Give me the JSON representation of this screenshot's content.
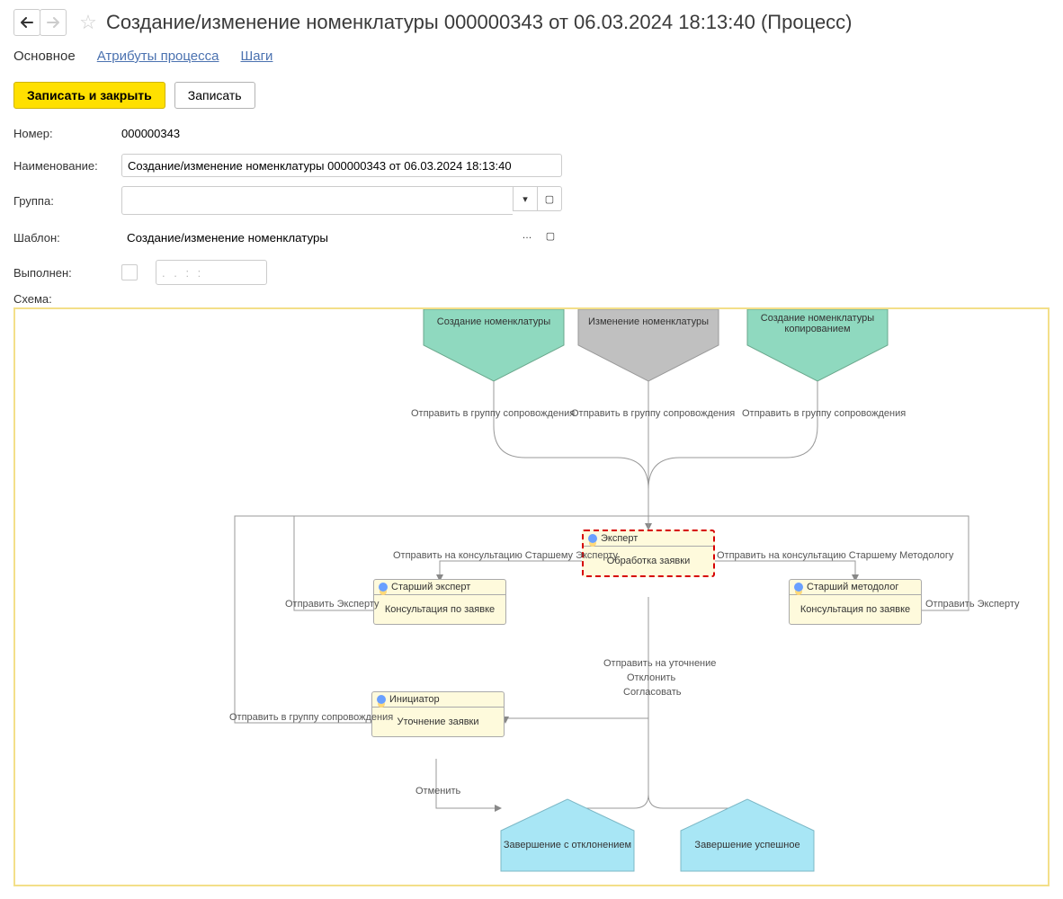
{
  "header": {
    "title": "Создание/изменение номенклатуры 000000343 от 06.03.2024 18:13:40 (Процесс)"
  },
  "tabs": {
    "main": "Основное",
    "attrs": "Атрибуты процесса",
    "steps": "Шаги"
  },
  "actions": {
    "save_close": "Записать и закрыть",
    "save": "Записать"
  },
  "form": {
    "number_label": "Номер:",
    "number_value": "000000343",
    "name_label": "Наименование:",
    "name_value": "Создание/изменение номенклатуры 000000343 от 06.03.2024 18:13:40",
    "group_label": "Группа:",
    "group_value": "",
    "template_label": "Шаблон:",
    "template_value": "Создание/изменение номенклатуры",
    "done_label": "Выполнен:",
    "done_checked": false,
    "date_mask": " .  .     :  : ",
    "schema_label": "Схема:"
  },
  "scheme": {
    "starts": [
      {
        "id": "create",
        "label": "Создание номенклатуры",
        "fill": "#8fd9bf"
      },
      {
        "id": "change",
        "label": "Изменение номенклатуры",
        "fill": "#c0c0c0"
      },
      {
        "id": "copy",
        "label": "Создание номенклатуры копированием",
        "fill": "#8fd9bf"
      }
    ],
    "start_out_label": "Отправить в группу сопровождения",
    "tasks": {
      "expert": {
        "role": "Эксперт",
        "title": "Обработка заявки",
        "highlight": true
      },
      "senior_exp": {
        "role": "Старший эксперт",
        "title": "Консультация по заявке",
        "highlight": false
      },
      "senior_met": {
        "role": "Старший методолог",
        "title": "Консультация по заявке",
        "highlight": false
      },
      "initiator": {
        "role": "Инициатор",
        "title": "Уточнение заявки",
        "highlight": false
      }
    },
    "labels": {
      "to_sen_exp": "Отправить на консультацию Старшему Эксперту",
      "to_sen_met": "Отправить на консультацию Старшему Методологу",
      "to_expert": "Отправить Эксперту",
      "to_support": "Отправить в группу сопровождения",
      "refine": "Отправить на уточнение",
      "reject": "Отклонить",
      "approve": "Согласовать",
      "cancel": "Отменить"
    },
    "ends": {
      "fail": "Завершение с отклонением",
      "ok": "Завершение успешное"
    }
  }
}
